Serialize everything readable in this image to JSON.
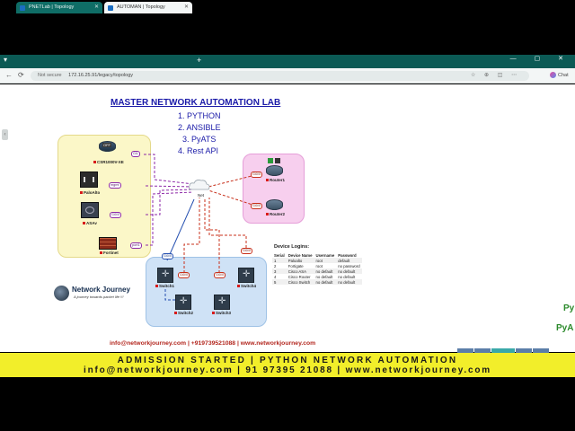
{
  "browser": {
    "tabs": [
      {
        "title": "PNETLab | Topology",
        "active": false
      },
      {
        "title": "AUTOMAN | Topology",
        "active": true
      }
    ],
    "new_tab": "+",
    "tab_menu": "▾",
    "window_controls": "— ▢ ✕",
    "back": "←",
    "reload": "⟳",
    "security_label": "Not secure",
    "url": "172.16.25.91/legacy/topology",
    "url_icons": "☆ ⊕ ◫ ⋯",
    "copilot_label": "Chat"
  },
  "lab": {
    "title": "MASTER NETWORK AUTOMATION LAB",
    "items": [
      "1. PYTHON",
      "2. ANSIBLE",
      "3. PyATS",
      "4. Rest API"
    ]
  },
  "devices": {
    "csr": {
      "name": "CSR1000V-XE",
      "status": "OFF"
    },
    "paloalto": {
      "name": "PaloAlto"
    },
    "asav": {
      "name": "ASAv"
    },
    "fortinet": {
      "name": "Fortinet"
    },
    "cloud": {
      "name": "Net"
    },
    "router1": {
      "name": "Router1"
    },
    "router2": {
      "name": "Router2"
    },
    "switch1": {
      "name": "Switch1"
    },
    "switch2": {
      "name": "Switch2"
    },
    "switch3": {
      "name": "Switch3"
    },
    "switch4": {
      "name": "Switch4"
    }
  },
  "ports": {
    "csr": "Gi1",
    "paloalto": "mgmt",
    "asav": "Gi0/0",
    "fortinet": "port1",
    "router1": "Gi0/0",
    "router2": "Gi0/0",
    "switch1_up": "Gi0/0",
    "switch1_down": "Gi0/0",
    "switch3": "Gi0/0",
    "switch4": "Gi0/0"
  },
  "logins": {
    "title": "Device Logins:",
    "headers": [
      "Serial",
      "Device Name",
      "Username",
      "Password"
    ],
    "rows": [
      [
        "1",
        "Paloalto",
        "root",
        "default"
      ],
      [
        "2",
        "Fortigate",
        "root",
        "no password"
      ],
      [
        "3",
        "Cisco ASA",
        "no default",
        "no default"
      ],
      [
        "4",
        "Cisco Router",
        "no default",
        "no default"
      ],
      [
        "5",
        "Cisco Switch",
        "no default",
        "no default"
      ]
    ]
  },
  "brand": {
    "name": "Network Journey",
    "tagline": "A journey towards packet life !!!",
    "contact": "info@networkjourney.com | +919739521088 | www.networkjourney.com"
  },
  "edge_text": [
    "Py",
    "PyA"
  ],
  "banner": {
    "line1": "ADMISSION STARTED | PYTHON NETWORK AUTOMATION",
    "line2": "info@networkjourney.com | 91 97395 21088 | www.networkjourney.com"
  },
  "colors": {
    "tab_bar": "#0b5a55",
    "banner": "#f2ee2a",
    "title_blue": "#1a1aa8",
    "contact_red": "#b3261e",
    "security_zone": "#fbf7c8",
    "router_zone": "#f7cfee",
    "switch_zone": "#cfe2f6"
  }
}
